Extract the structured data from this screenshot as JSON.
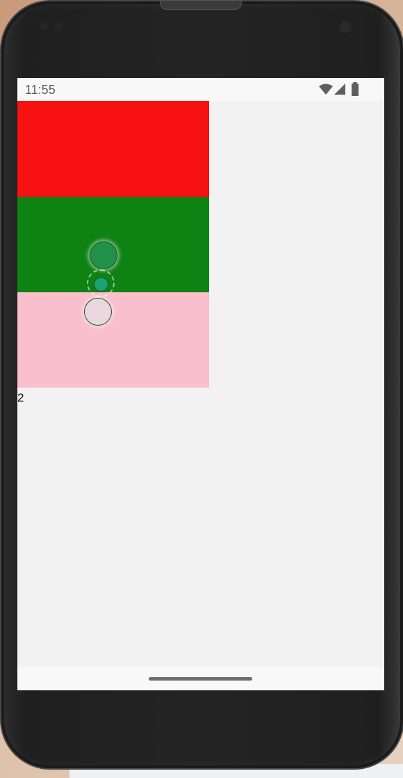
{
  "status_bar": {
    "time": "11:55",
    "icons": [
      "wifi-icon",
      "signal-icon",
      "battery-icon"
    ]
  },
  "blocks": [
    {
      "name": "red",
      "color": "#f71110"
    },
    {
      "name": "green",
      "color": "#0f8214"
    },
    {
      "name": "pink",
      "color": "#f9bfcb"
    }
  ],
  "counter": {
    "value": "2"
  },
  "nav_bar": {
    "home_indicator": "home-pill"
  }
}
